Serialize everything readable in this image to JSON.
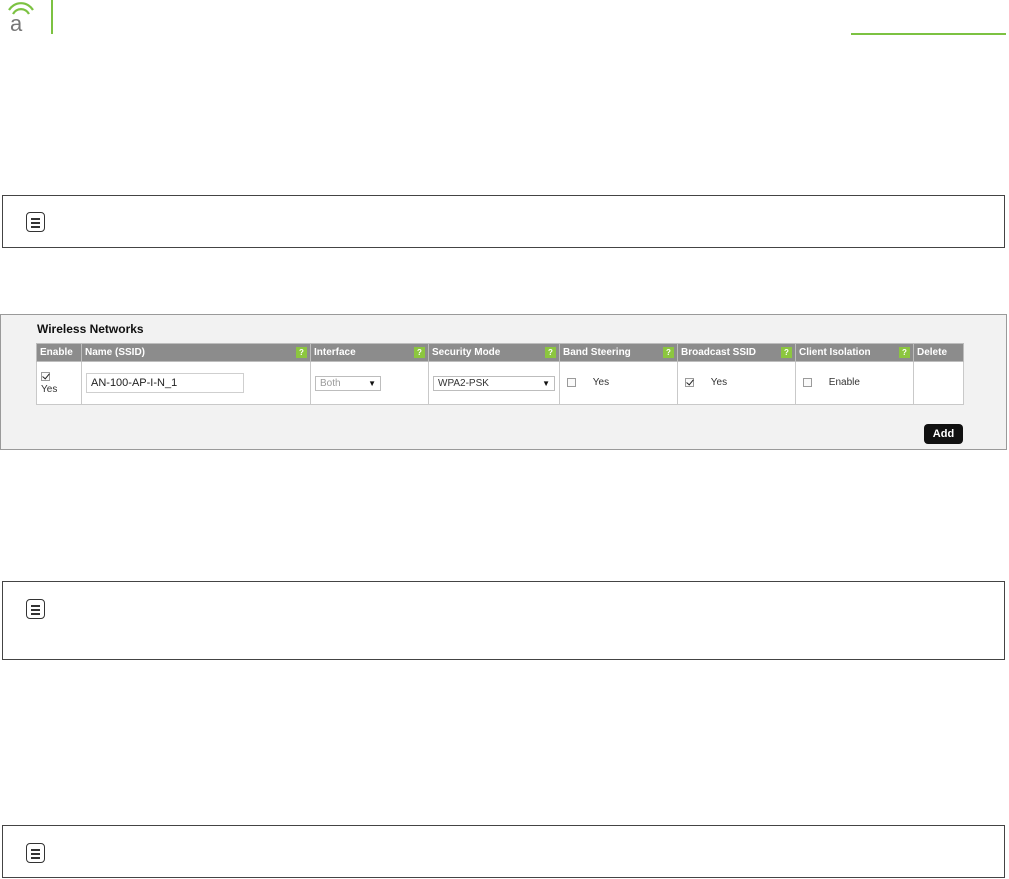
{
  "brand": {
    "logo_letter": "a",
    "accent_color": "#7cc242"
  },
  "notes": [
    {
      "icon": "note-icon",
      "text": ""
    },
    {
      "icon": "note-icon",
      "text": ""
    },
    {
      "icon": "note-icon",
      "text": ""
    }
  ],
  "wireless_networks": {
    "title": "Wireless Networks",
    "columns": [
      {
        "label": "Enable",
        "help": false
      },
      {
        "label": "Name (SSID)",
        "help": true
      },
      {
        "label": "Interface",
        "help": true
      },
      {
        "label": "Security Mode",
        "help": true
      },
      {
        "label": "Band Steering",
        "help": true
      },
      {
        "label": "Broadcast SSID",
        "help": true
      },
      {
        "label": "Client Isolation",
        "help": true
      },
      {
        "label": "Delete",
        "help": false
      }
    ],
    "help_glyph": "?",
    "rows": [
      {
        "enable": {
          "checked": true,
          "label": "Yes"
        },
        "ssid": "AN-100-AP-I-N_1",
        "interface": {
          "value": "Both",
          "disabled": true
        },
        "security_mode": "WPA2-PSK",
        "band_steering": {
          "checked": false,
          "label": "Yes"
        },
        "broadcast_ssid": {
          "checked": true,
          "label": "Yes"
        },
        "client_isolation": {
          "checked": false,
          "label": "Enable"
        }
      }
    ],
    "add_label": "Add"
  }
}
